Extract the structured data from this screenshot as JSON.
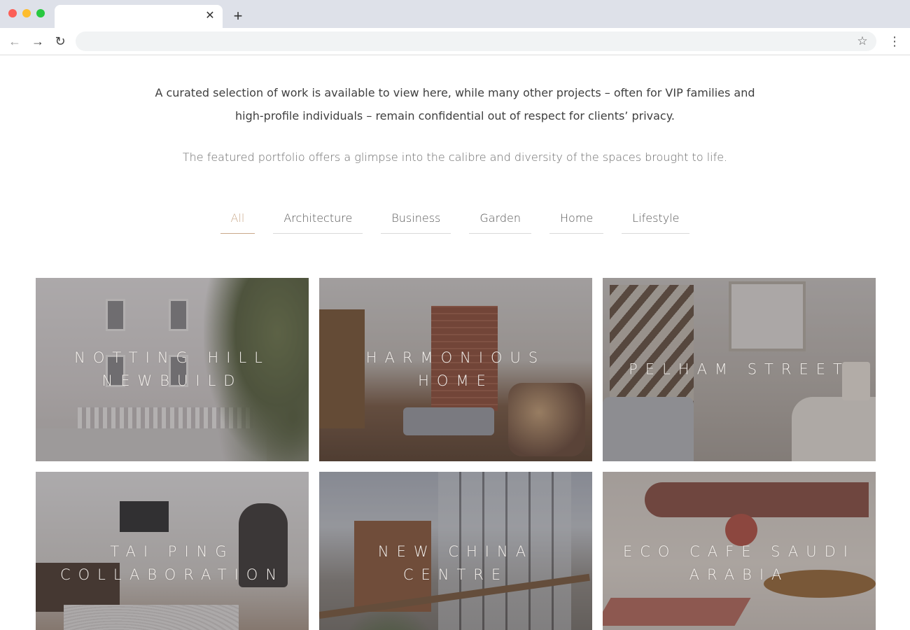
{
  "browser": {
    "tab_title": "",
    "tab_close_glyph": "✕",
    "new_tab_glyph": "+",
    "back_glyph": "←",
    "forward_glyph": "→",
    "reload_glyph": "↻",
    "url": "",
    "star_glyph": "☆",
    "menu_glyph": "⋮"
  },
  "intro": {
    "line1": "A curated selection of work is available to view here, while many other projects – often for VIP families and",
    "line2": "high-profile individuals – remain confidential out of respect for clients’ privacy.",
    "sub": "The featured portfolio offers a glimpse into the calibre and diversity of the spaces brought to life."
  },
  "filters": [
    {
      "label": "All",
      "active": true
    },
    {
      "label": "Architecture",
      "active": false
    },
    {
      "label": "Business",
      "active": false
    },
    {
      "label": "Garden",
      "active": false
    },
    {
      "label": "Home",
      "active": false
    },
    {
      "label": "Lifestyle",
      "active": false
    }
  ],
  "projects": [
    {
      "title": "Notting Hill Newbuild"
    },
    {
      "title": "Harmonious Home"
    },
    {
      "title": "Pelham Street"
    },
    {
      "title": "Tai Ping Collaboration"
    },
    {
      "title": "New China Centre"
    },
    {
      "title": "Eco Cafe Saudi Arabia"
    }
  ],
  "colors": {
    "accent": "#c9a98a",
    "titlebar": "#dee1e9",
    "overlay": "#3c3737"
  }
}
